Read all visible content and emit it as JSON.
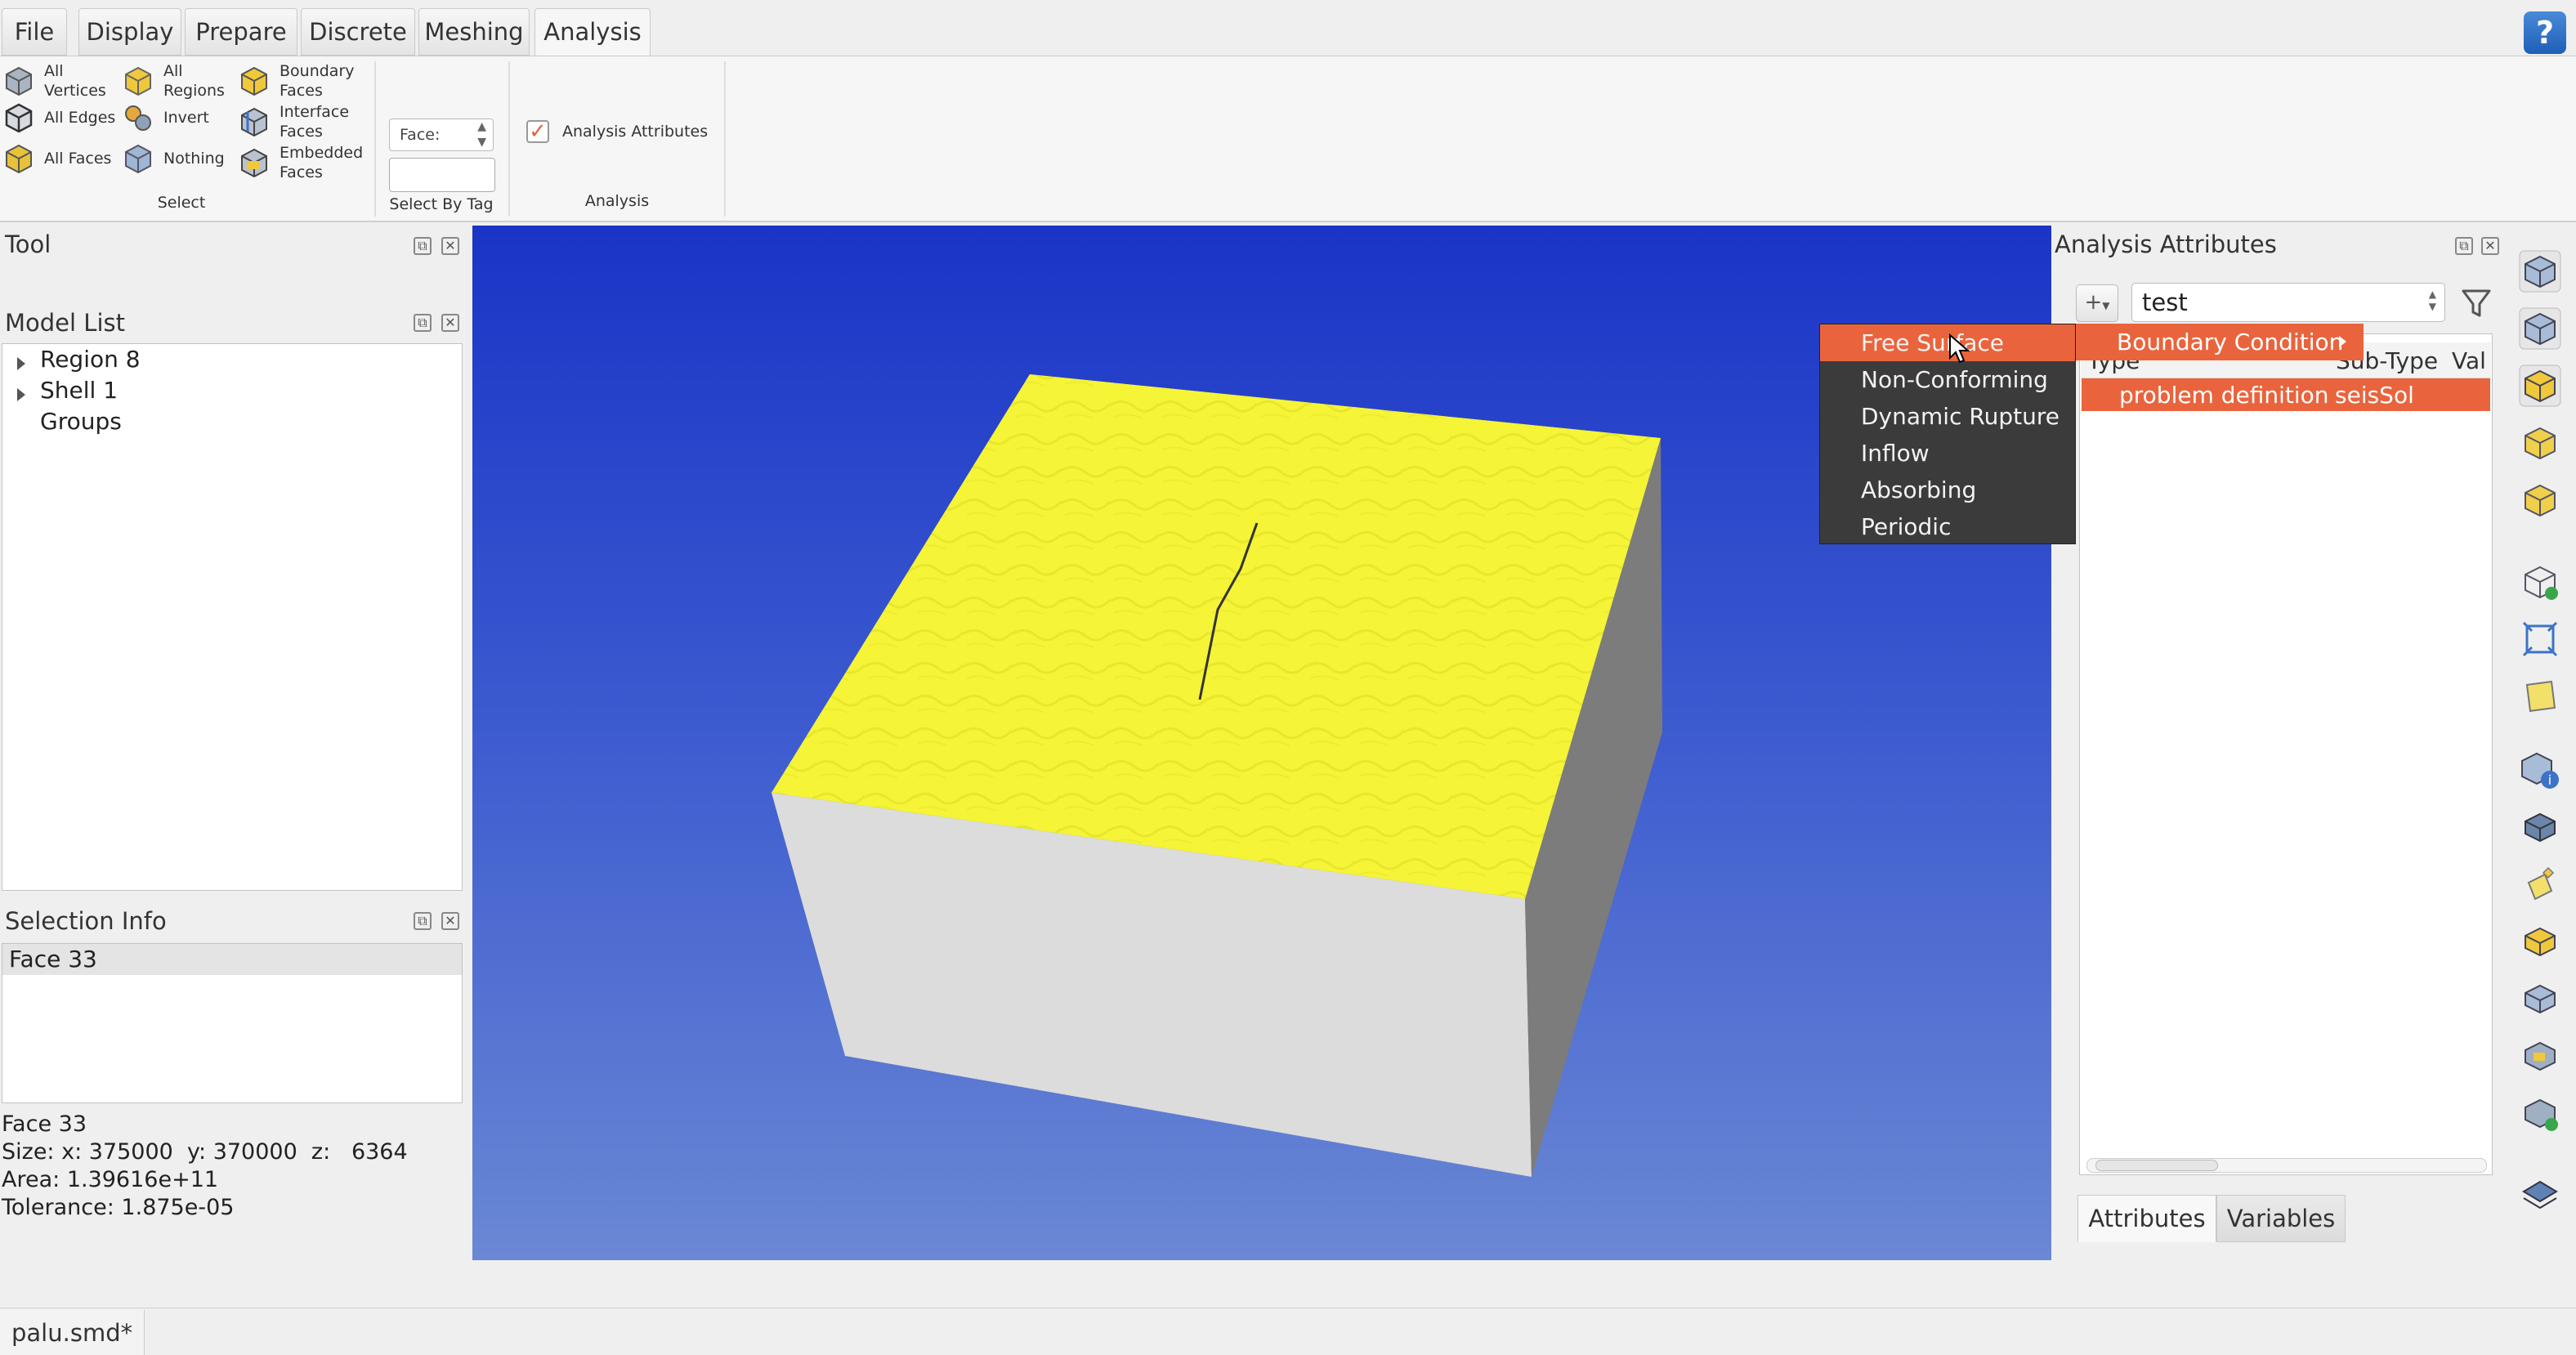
{
  "menubar": {
    "tabs": [
      "File",
      "Display",
      "Prepare",
      "Discrete",
      "Meshing",
      "Analysis"
    ],
    "active_tab": "Analysis",
    "help": "?"
  },
  "ribbon": {
    "select": {
      "col1": [
        "All Vertices",
        "All Edges",
        "All Faces"
      ],
      "col2": [
        "All Regions",
        "Invert",
        "Nothing"
      ],
      "col3": [
        "Boundary Faces",
        "Interface Faces",
        "Embedded Faces"
      ],
      "group_label": "Select"
    },
    "select_by_tag": {
      "combo_value": "Face:",
      "input_value": "",
      "group_label": "Select By Tag"
    },
    "analysis": {
      "checkbox_label": "Analysis Attributes",
      "checked": true,
      "group_label": "Analysis"
    }
  },
  "left": {
    "tool_title": "Tool",
    "model_list_title": "Model List",
    "tree": [
      "Region 8",
      "Shell 1",
      "Groups"
    ],
    "selection_info_title": "Selection Info",
    "selection_item": "Face 33",
    "info_lines": [
      "Face 33",
      "Size: x: 375000  y: 370000  z:   6364",
      "Area: 1.39616e+11",
      "Tolerance: 1.875e-05"
    ]
  },
  "context_menu": {
    "items": [
      "Free Surface",
      "Non-Conforming",
      "Dynamic Rupture",
      "Inflow",
      "Absorbing",
      "Periodic"
    ],
    "highlighted": "Free Surface",
    "submenu": "Boundary Condition"
  },
  "attributes": {
    "title": "Analysis Attributes",
    "add_label": "+",
    "case_value": "test",
    "columns": [
      "Type",
      "Sub-Type",
      "Val"
    ],
    "row": {
      "type": "problem definition",
      "subtype": "seisSol"
    },
    "tabs": [
      "Attributes",
      "Variables"
    ]
  },
  "status": {
    "document": "palu.smd*"
  },
  "colors": {
    "accent": "#e9643d",
    "surface": "#f5f53a",
    "viewport_top": "#1a34c6"
  }
}
